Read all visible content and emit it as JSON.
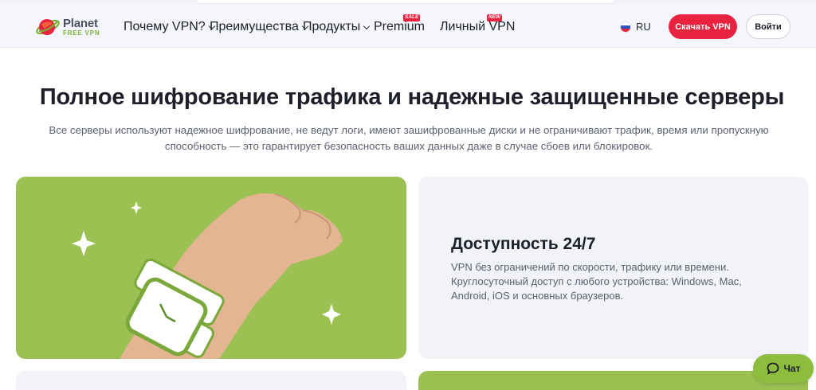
{
  "brand": {
    "name_line1": "Planet",
    "name_line2": "FREE VPN"
  },
  "nav": {
    "items": [
      {
        "label": "Почему VPN?",
        "dropdown": true
      },
      {
        "label": "Преимущества",
        "dropdown": true
      },
      {
        "label": "Продукты",
        "dropdown": true
      },
      {
        "label": "Premium",
        "dropdown": false,
        "tag": "SALE"
      },
      {
        "label": "Личный VPN",
        "dropdown": false,
        "tag": "NEW"
      }
    ],
    "language": "RU",
    "language_flag": "russia-flag-icon",
    "download_button": "Скачать VPN",
    "login_button": "Войти"
  },
  "hero": {
    "title": "Полное шифрование трафика и надежные защищенные серверы",
    "subtitle": "Все серверы используют надежное шифрование, не ведут логи, имеют зашифрованные диски и не ограничивают трафик, время или пропускную способность — это гарантирует безопасность ваших данных даже в случае сбоев или блокировок."
  },
  "feature": {
    "title": "Доступность 24/7",
    "text": "VPN без ограничений по скорости, трафику или времени. Круглосуточный доступ с любого устройства: Windows, Mac, Android, iOS и основных браузеров.",
    "image_icon": "wristwatch-hand-illustration"
  },
  "chat": {
    "label": "Чат",
    "icon": "chat-bubble-icon"
  },
  "colors": {
    "accent_red": "#e8223f",
    "brand_green": "#9bc152",
    "chat_green": "#8dbd3c",
    "panel_bg": "#f1f3f9"
  }
}
